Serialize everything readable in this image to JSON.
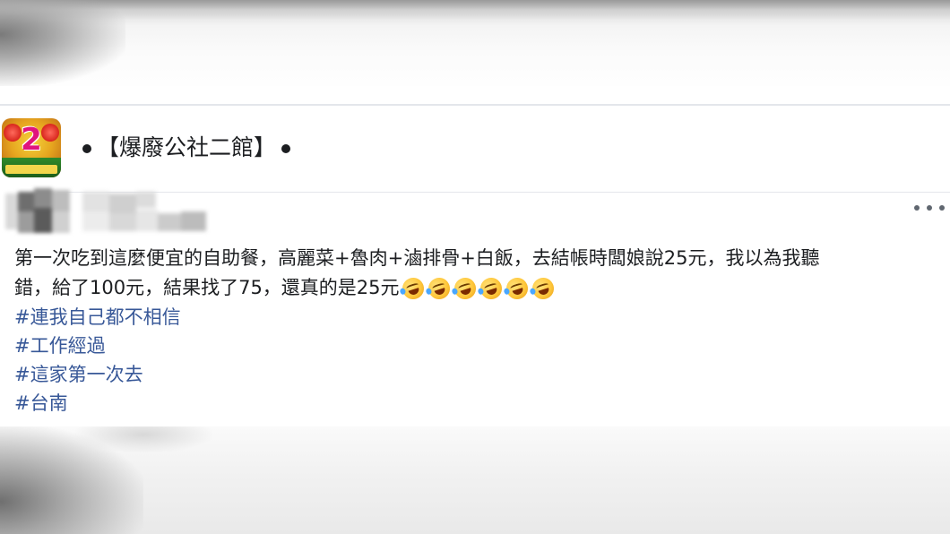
{
  "group": {
    "name": "【爆廢公社二館】",
    "logo_icon": "group-logo-icon"
  },
  "post": {
    "text_line_1": "第一次吃到這麼便宜的自助餐，高麗菜+魯肉+滷排骨+白飯，去結帳時闆娘說25元，我以為我聽",
    "text_line_2": "錯，給了100元，結果找了75，還真的是25元",
    "emoji_count": 6,
    "emoji_icon": "rolling-on-floor-laughing-emoji",
    "hashtags": [
      "#連我自己都不相信",
      "#工作經過",
      "#這家第一次去",
      "#台南"
    ],
    "more_icon": "more-options-icon"
  },
  "colors": {
    "text": "#1c1e21",
    "hashtag": "#385898",
    "divider": "#e4e6eb",
    "more_dots": "#606770"
  }
}
